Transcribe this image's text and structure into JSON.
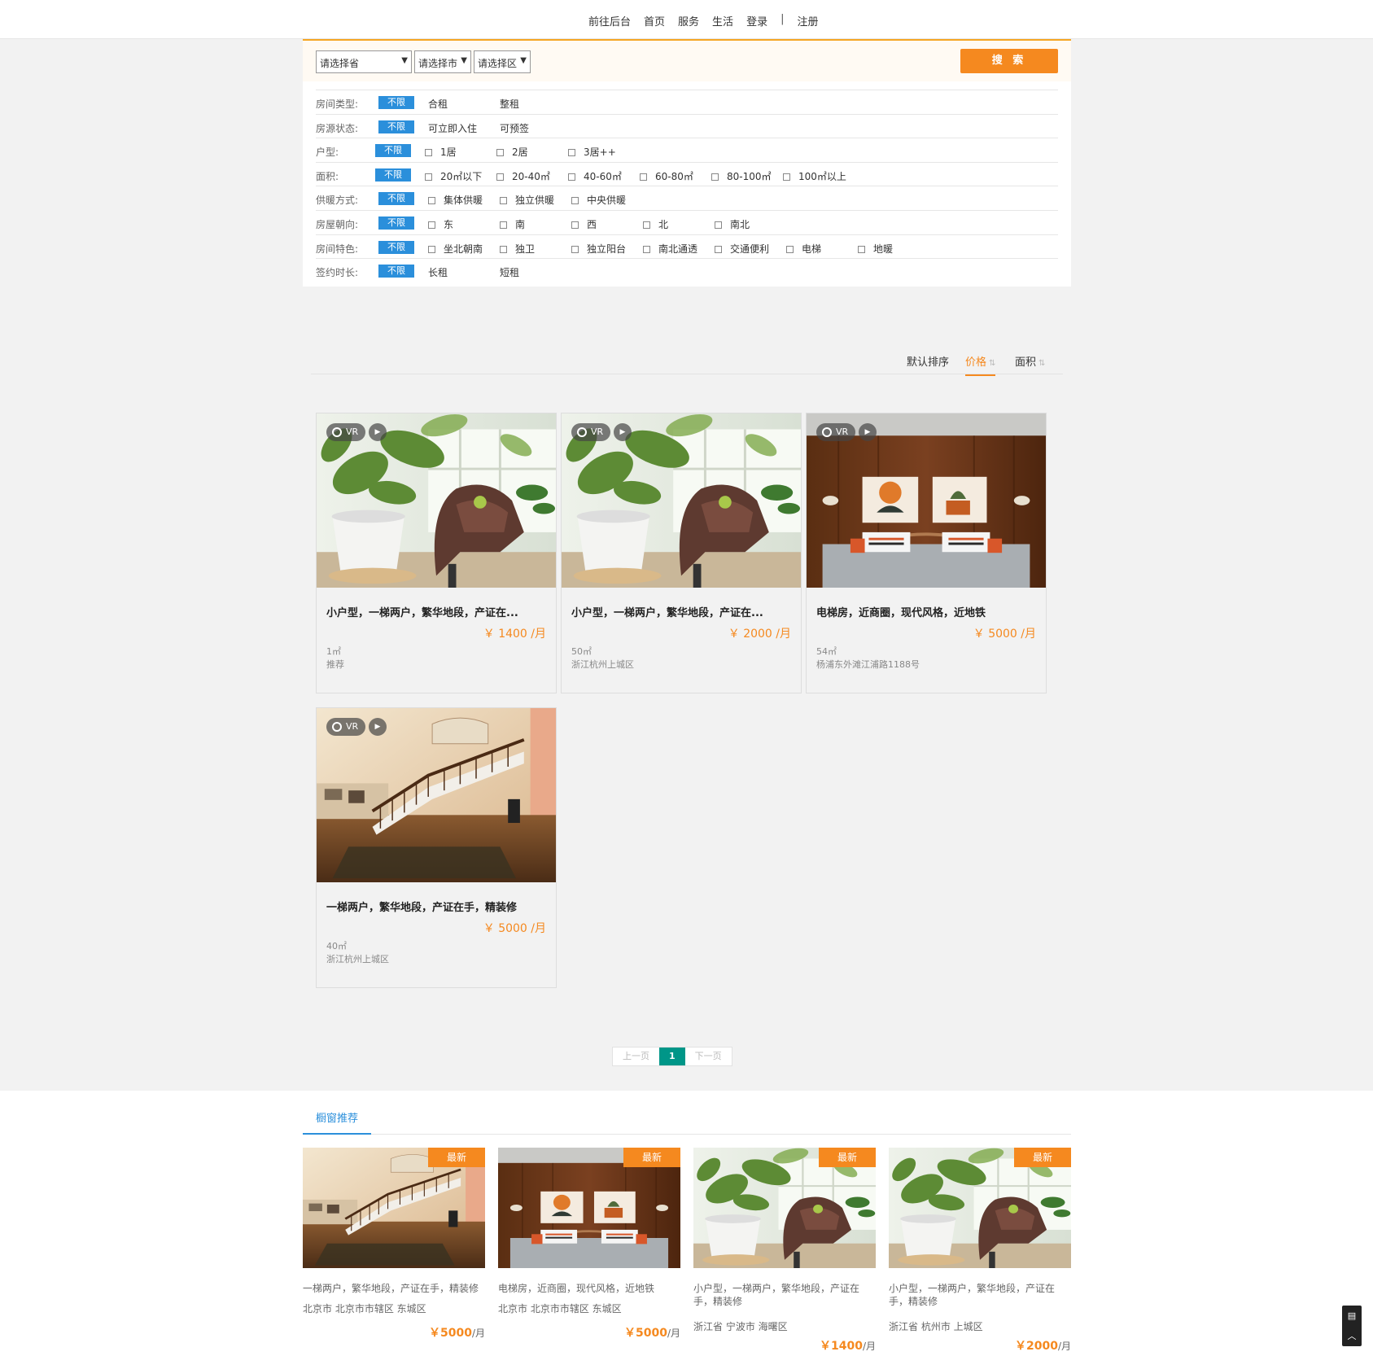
{
  "nav": {
    "links": [
      "前往后台",
      "首页",
      "服务",
      "生活",
      "登录",
      "|",
      "注册"
    ]
  },
  "filter": {
    "province_placeholder": "请选择省",
    "city_placeholder": "请选择市",
    "district_placeholder": "请选择区",
    "search_label": "搜 索",
    "unlimited": "不限",
    "rows": [
      {
        "label": "房间类型:",
        "options": [
          "合租",
          "整租"
        ],
        "checkbox": false
      },
      {
        "label": "房源状态:",
        "options": [
          "可立即入住",
          "可预签"
        ],
        "checkbox": false
      },
      {
        "label": "户型:",
        "options": [
          "1居",
          "2居",
          "3居++"
        ],
        "checkbox": true
      },
      {
        "label": "面积:",
        "options": [
          "20㎡以下",
          "20-40㎡",
          "40-60㎡",
          "60-80㎡",
          "80-100㎡",
          "100㎡以上"
        ],
        "checkbox": true
      },
      {
        "label": "供暖方式:",
        "options": [
          "集体供暖",
          "独立供暖",
          "中央供暖"
        ],
        "checkbox": true
      },
      {
        "label": "房屋朝向:",
        "options": [
          "东",
          "南",
          "西",
          "北",
          "南北"
        ],
        "checkbox": true
      },
      {
        "label": "房间特色:",
        "options": [
          "坐北朝南",
          "独卫",
          "独立阳台",
          "南北通透",
          "交通便利",
          "电梯",
          "地暖"
        ],
        "checkbox": true
      },
      {
        "label": "签约时长:",
        "options": [
          "长租",
          "短租"
        ],
        "checkbox": false
      }
    ]
  },
  "sort": {
    "default": "默认排序",
    "price": "价格",
    "area": "面积",
    "active": "price"
  },
  "listings": [
    {
      "title": "小户型，一梯两户，繁华地段，产证在...",
      "price": "￥  1400 /月",
      "area": "1㎡",
      "addr": "推荐",
      "image": "plant-chair"
    },
    {
      "title": "小户型，一梯两户，繁华地段，产证在...",
      "price": "￥  2000 /月",
      "area": "50㎡",
      "addr": "浙江杭州上城区",
      "image": "plant-chair"
    },
    {
      "title": "电梯房，近商圈，现代风格，近地铁",
      "price": "￥  5000 /月",
      "area": "54㎡",
      "addr": "杨浦东外滩江浦路1188号",
      "image": "bedroom"
    },
    {
      "title": "一梯两户，繁华地段，产证在手，精装修",
      "price": "￥  5000 /月",
      "area": "40㎡",
      "addr": "浙江杭州上城区",
      "image": "staircase"
    }
  ],
  "vr_label": "VR",
  "pager": {
    "prev": "上一页",
    "current": "1",
    "next": "下一页"
  },
  "recommend": {
    "tab": "橱窗推荐",
    "tag": "最新",
    "items": [
      {
        "title": "一梯两户，繁华地段，产证在手，精装修",
        "addr": "北京市 北京市市辖区 东城区",
        "price": "￥5000",
        "unit": "/月",
        "image": "staircase"
      },
      {
        "title": "电梯房，近商圈，现代风格，近地铁",
        "addr": "北京市 北京市市辖区 东城区",
        "price": "￥5000",
        "unit": "/月",
        "image": "bedroom"
      },
      {
        "title": "小户型，一梯两户，繁华地段，产证在手，精装修",
        "addr": "浙江省 宁波市 海曙区",
        "price": "￥1400",
        "unit": "/月",
        "image": "plant-chair"
      },
      {
        "title": "小户型，一梯两户，繁华地段，产证在手，精装修",
        "addr": "浙江省 杭州市 上城区",
        "price": "￥2000",
        "unit": "/月",
        "image": "plant-chair"
      }
    ]
  },
  "colors": {
    "accent": "#f5891f",
    "blue": "#2b8fdb",
    "pager": "#009688"
  }
}
